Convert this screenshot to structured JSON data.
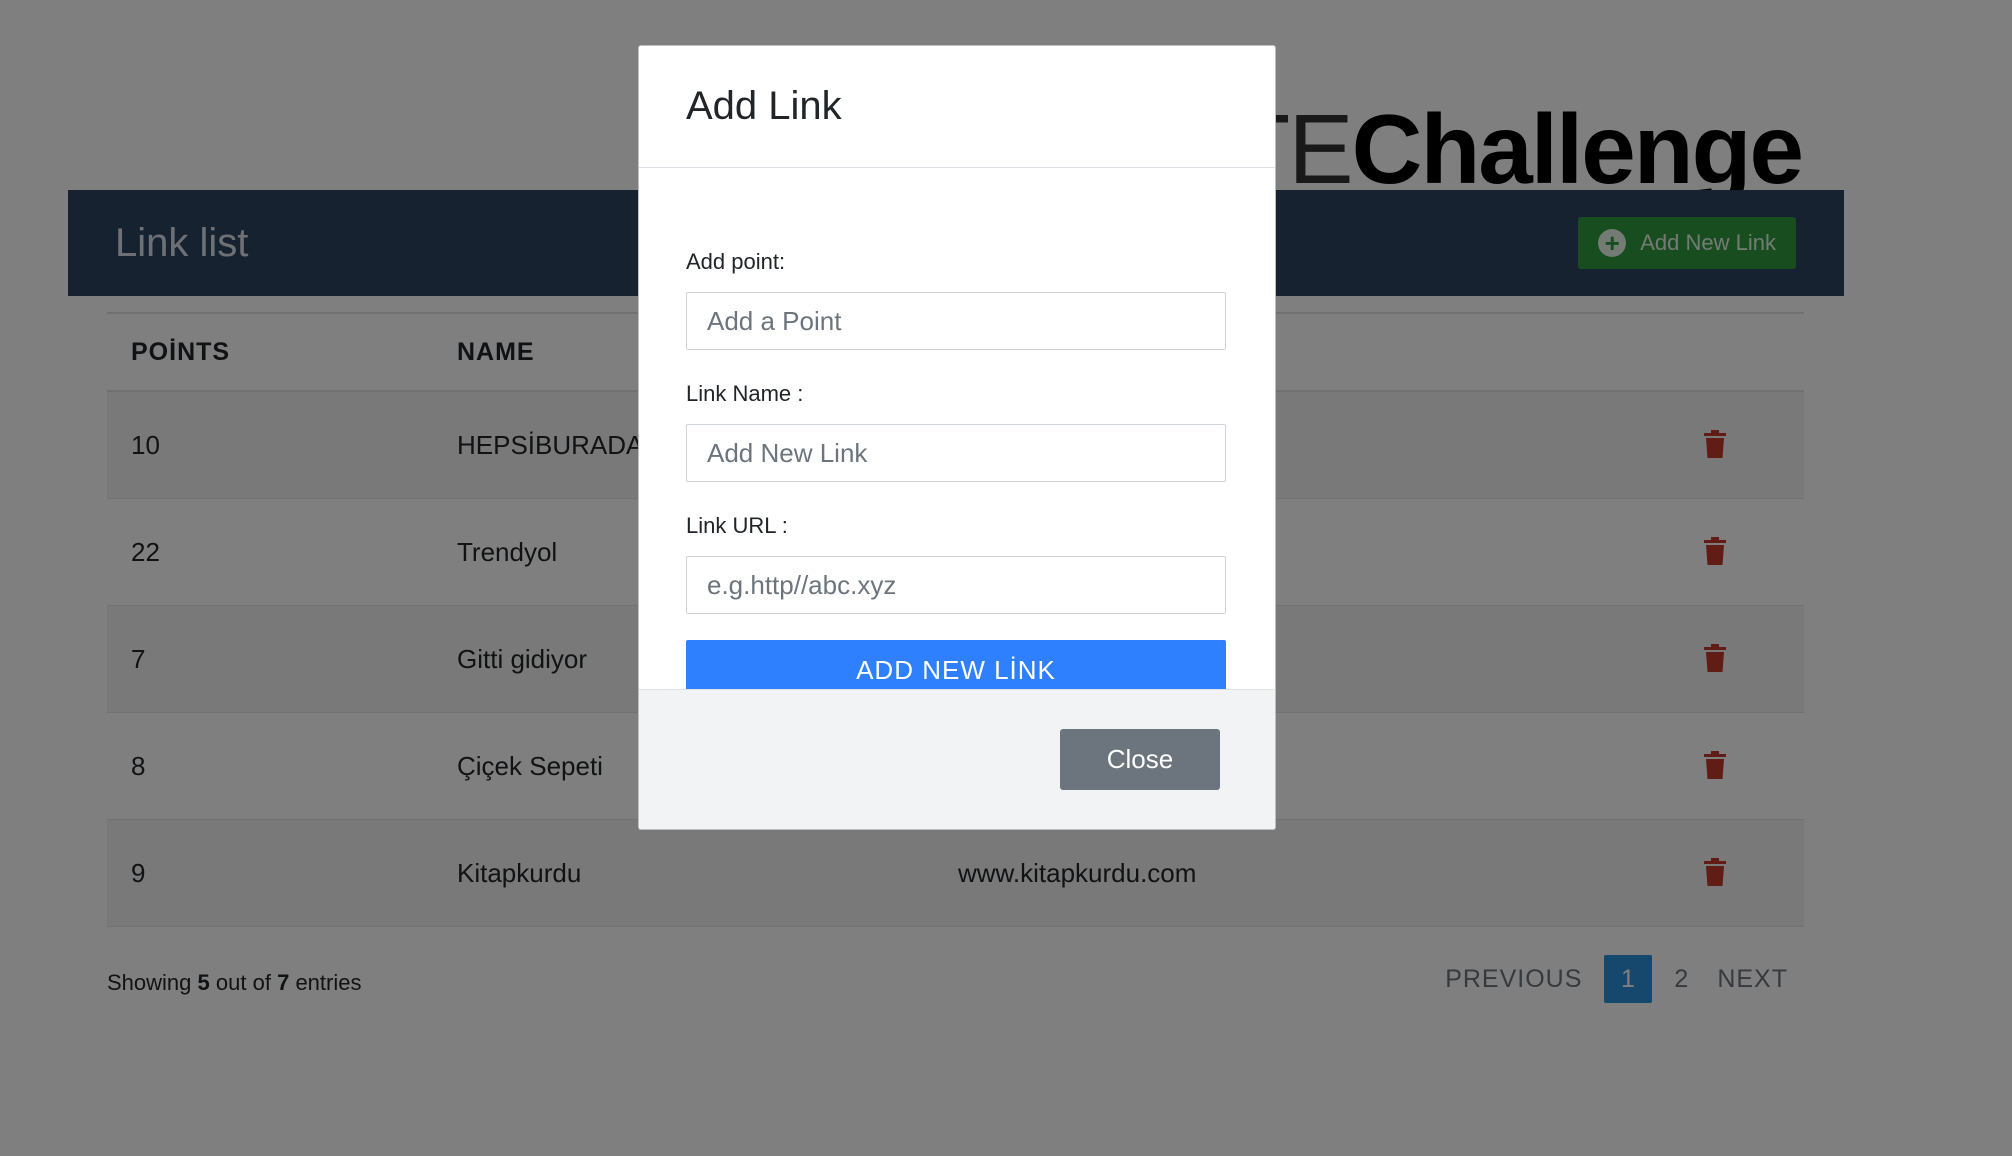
{
  "brand": {
    "light": "OTE",
    "bold": "Challenge"
  },
  "card": {
    "title": "Link list",
    "add_button": "Add New Link"
  },
  "table": {
    "headers": {
      "points": "POİNTS",
      "name": "NAME"
    },
    "rows": [
      {
        "points": "10",
        "name": "HEPSİBURADA",
        "url": ""
      },
      {
        "points": "22",
        "name": "Trendyol",
        "url": ""
      },
      {
        "points": "7",
        "name": "Gitti gidiyor",
        "url": ""
      },
      {
        "points": "8",
        "name": "Çiçek Sepeti",
        "url": ""
      },
      {
        "points": "9",
        "name": "Kitapkurdu",
        "url": "www.kitapkurdu.com"
      }
    ]
  },
  "summary": {
    "prefix": "Showing",
    "shown": "5",
    "middle": "out of",
    "total": "7",
    "suffix": "entries"
  },
  "pagination": {
    "previous": "PREVIOUS",
    "pages": [
      "1",
      "2"
    ],
    "active": "1",
    "next": "NEXT"
  },
  "modal": {
    "title": "Add Link",
    "point_label": "Add point:",
    "point_placeholder": "Add a Point",
    "name_label": "Link Name :",
    "name_placeholder": "Add New Link",
    "url_label": "Link URL :",
    "url_placeholder": "e.g.http//abc.xyz",
    "submit": "ADD NEW LİNK",
    "close": "Close"
  },
  "colors": {
    "header_bg": "#2f4562",
    "add_button_bg": "#2f9a3f",
    "trash_icon": "#c0392b",
    "primary_button": "#2f80ff",
    "close_button": "#6c757d",
    "active_page": "#2d8fd8"
  }
}
